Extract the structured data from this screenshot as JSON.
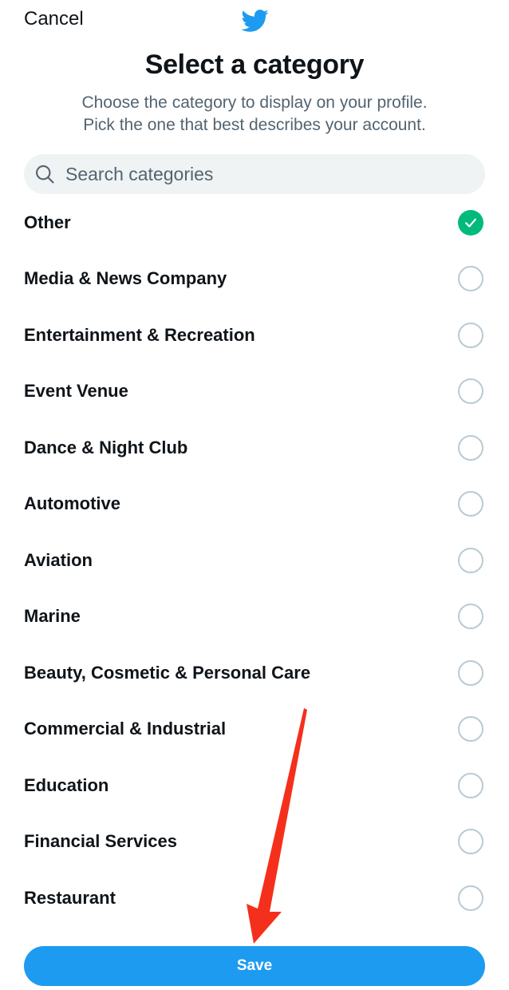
{
  "header": {
    "cancel_label": "Cancel",
    "logo_icon": "twitter-bird-icon",
    "brand_color": "#1d9bf0"
  },
  "title": "Select a category",
  "subtitle": {
    "line1": "Choose the category to display on your profile.",
    "line2": "Pick the one that best describes your account."
  },
  "search": {
    "icon": "search-icon",
    "placeholder": "Search categories",
    "value": ""
  },
  "categories": [
    {
      "label": "Other",
      "selected": true
    },
    {
      "label": "Media & News Company",
      "selected": false
    },
    {
      "label": "Entertainment & Recreation",
      "selected": false
    },
    {
      "label": "Event Venue",
      "selected": false
    },
    {
      "label": "Dance & Night Club",
      "selected": false
    },
    {
      "label": "Automotive",
      "selected": false
    },
    {
      "label": "Aviation",
      "selected": false
    },
    {
      "label": "Marine",
      "selected": false
    },
    {
      "label": "Beauty, Cosmetic & Personal Care",
      "selected": false
    },
    {
      "label": "Commercial & Industrial",
      "selected": false
    },
    {
      "label": "Education",
      "selected": false
    },
    {
      "label": "Financial Services",
      "selected": false
    },
    {
      "label": "Restaurant",
      "selected": false
    }
  ],
  "selected_color": "#00ba7c",
  "footer": {
    "save_label": "Save",
    "save_color": "#1d9bf0"
  },
  "annotation": {
    "icon": "red-arrow-icon",
    "color": "#f4301c"
  }
}
